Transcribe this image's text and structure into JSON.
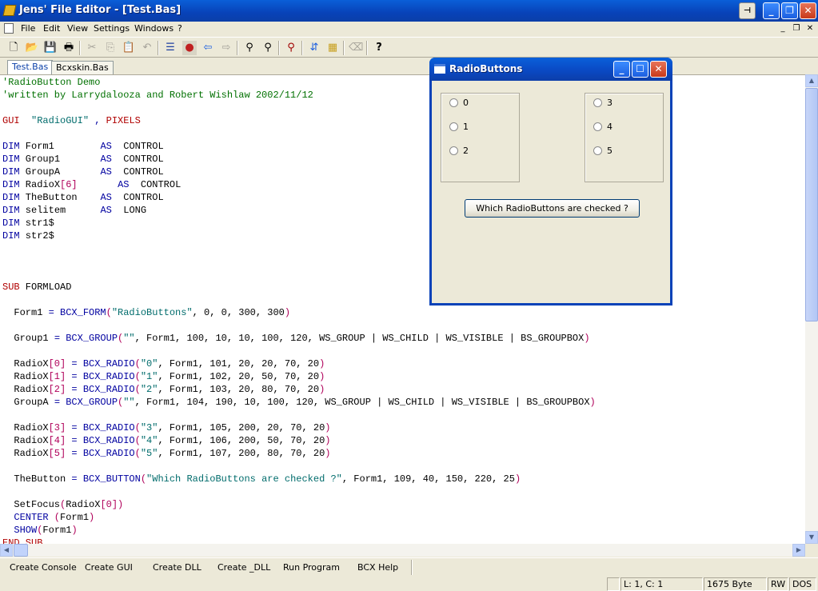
{
  "window": {
    "title": "Jens' File Editor - [Test.Bas]",
    "buttons": {
      "pin": "⊣",
      "minimize": "_",
      "maximize": "❐",
      "close": "✕"
    }
  },
  "menu": {
    "items": [
      "File",
      "Edit",
      "View",
      "Settings",
      "Windows",
      "?"
    ],
    "mdi": {
      "minimize": "_",
      "restore": "❐",
      "close": "✕"
    }
  },
  "toolbar": {
    "icons": [
      "new-file-icon",
      "open-folder-icon",
      "save-icon",
      "print-icon",
      "cut-icon",
      "copy-icon",
      "paste-icon",
      "undo-icon",
      "list-icon",
      "color-icon",
      "back-icon",
      "forward-icon",
      "find-icon",
      "find-replace-icon",
      "find-next-icon",
      "goto-icon",
      "compile-icon",
      "delete-icon",
      "help-icon"
    ]
  },
  "tabs": [
    {
      "label": "Test.Bas",
      "active": true
    },
    {
      "label": "Bcxskin.Bas",
      "active": false
    }
  ],
  "code_lines": [
    [
      [
        "cm",
        "'RadioButton Demo"
      ]
    ],
    [
      [
        "cm",
        "'written by Larrydalooza and Robert Wishlaw 2002/11/12"
      ]
    ],
    [],
    [
      [
        "kw",
        "GUI"
      ],
      [
        "",
        "  "
      ],
      [
        "st",
        "\"RadioGUI\""
      ],
      [
        "kb",
        " , "
      ],
      [
        "kw",
        "PIXELS"
      ]
    ],
    [],
    [
      [
        "kb",
        "DIM"
      ],
      [
        "",
        " Form1        "
      ],
      [
        "kb",
        "AS"
      ],
      [
        "",
        "  CONTROL"
      ]
    ],
    [
      [
        "kb",
        "DIM"
      ],
      [
        "",
        " Group1       "
      ],
      [
        "kb",
        "AS"
      ],
      [
        "",
        "  CONTROL"
      ]
    ],
    [
      [
        "kb",
        "DIM"
      ],
      [
        "",
        " GroupA       "
      ],
      [
        "kb",
        "AS"
      ],
      [
        "",
        "  CONTROL"
      ]
    ],
    [
      [
        "kb",
        "DIM"
      ],
      [
        "",
        " RadioX"
      ],
      [
        "nm",
        "[6]"
      ],
      [
        "",
        "       "
      ],
      [
        "kb",
        "AS"
      ],
      [
        "",
        "  CONTROL"
      ]
    ],
    [
      [
        "kb",
        "DIM"
      ],
      [
        "",
        " TheButton    "
      ],
      [
        "kb",
        "AS"
      ],
      [
        "",
        "  CONTROL"
      ]
    ],
    [
      [
        "kb",
        "DIM"
      ],
      [
        "",
        " selitem      "
      ],
      [
        "kb",
        "AS"
      ],
      [
        "",
        "  LONG"
      ]
    ],
    [
      [
        "kb",
        "DIM"
      ],
      [
        "",
        " str1$"
      ]
    ],
    [
      [
        "kb",
        "DIM"
      ],
      [
        "",
        " str2$"
      ]
    ],
    [],
    [],
    [],
    [
      [
        "kw",
        "SUB"
      ],
      [
        "",
        " FORMLOAD"
      ]
    ],
    [],
    [
      [
        "",
        "  Form1 "
      ],
      [
        "kb",
        "="
      ],
      [
        "kb",
        " BCX_FORM"
      ],
      [
        "nm",
        "("
      ],
      [
        "st",
        "\"RadioButtons\""
      ],
      [
        "",
        ", 0, 0, 300, 300"
      ],
      [
        "nm",
        ")"
      ]
    ],
    [],
    [
      [
        "",
        "  Group1 "
      ],
      [
        "kb",
        "="
      ],
      [
        "kb",
        " BCX_GROUP"
      ],
      [
        "nm",
        "("
      ],
      [
        "st",
        "\"\""
      ],
      [
        "",
        ", Form1, 100, 10, 10, 100, 120, WS_GROUP | WS_CHILD | WS_VISIBLE | BS_GROUPBOX"
      ],
      [
        "nm",
        ")"
      ]
    ],
    [],
    [
      [
        "",
        "  RadioX"
      ],
      [
        "nm",
        "[0]"
      ],
      [
        "kb",
        " = BCX_RADIO"
      ],
      [
        "nm",
        "("
      ],
      [
        "st",
        "\"0\""
      ],
      [
        "",
        ", Form1, 101, 20, 20, 70, 20"
      ],
      [
        "nm",
        ")"
      ]
    ],
    [
      [
        "",
        "  RadioX"
      ],
      [
        "nm",
        "[1]"
      ],
      [
        "kb",
        " = BCX_RADIO"
      ],
      [
        "nm",
        "("
      ],
      [
        "st",
        "\"1\""
      ],
      [
        "",
        ", Form1, 102, 20, 50, 70, 20"
      ],
      [
        "nm",
        ")"
      ]
    ],
    [
      [
        "",
        "  RadioX"
      ],
      [
        "nm",
        "[2]"
      ],
      [
        "kb",
        " = BCX_RADIO"
      ],
      [
        "nm",
        "("
      ],
      [
        "st",
        "\"2\""
      ],
      [
        "",
        ", Form1, 103, 20, 80, 70, 20"
      ],
      [
        "nm",
        ")"
      ]
    ],
    [
      [
        "",
        "  GroupA "
      ],
      [
        "kb",
        "="
      ],
      [
        "kb",
        " BCX_GROUP"
      ],
      [
        "nm",
        "("
      ],
      [
        "st",
        "\"\""
      ],
      [
        "",
        ", Form1, 104, 190, 10, 100, 120, WS_GROUP | WS_CHILD | WS_VISIBLE | BS_GROUPBOX"
      ],
      [
        "nm",
        ")"
      ]
    ],
    [],
    [
      [
        "",
        "  RadioX"
      ],
      [
        "nm",
        "[3]"
      ],
      [
        "kb",
        " = BCX_RADIO"
      ],
      [
        "nm",
        "("
      ],
      [
        "st",
        "\"3\""
      ],
      [
        "",
        ", Form1, 105, 200, 20, 70, 20"
      ],
      [
        "nm",
        ")"
      ]
    ],
    [
      [
        "",
        "  RadioX"
      ],
      [
        "nm",
        "[4]"
      ],
      [
        "kb",
        " = BCX_RADIO"
      ],
      [
        "nm",
        "("
      ],
      [
        "st",
        "\"4\""
      ],
      [
        "",
        ", Form1, 106, 200, 50, 70, 20"
      ],
      [
        "nm",
        ")"
      ]
    ],
    [
      [
        "",
        "  RadioX"
      ],
      [
        "nm",
        "[5]"
      ],
      [
        "kb",
        " = BCX_RADIO"
      ],
      [
        "nm",
        "("
      ],
      [
        "st",
        "\"5\""
      ],
      [
        "",
        ", Form1, 107, 200, 80, 70, 20"
      ],
      [
        "nm",
        ")"
      ]
    ],
    [],
    [
      [
        "",
        "  TheButton "
      ],
      [
        "kb",
        "="
      ],
      [
        "kb",
        " BCX_BUTTON"
      ],
      [
        "nm",
        "("
      ],
      [
        "st",
        "\"Which RadioButtons are checked ?\""
      ],
      [
        "",
        ", Form1, 109, 40, 150, 220, 25"
      ],
      [
        "nm",
        ")"
      ]
    ],
    [],
    [
      [
        "",
        "  SetFocus"
      ],
      [
        "nm",
        "("
      ],
      [
        "",
        "RadioX"
      ],
      [
        "nm",
        "[0])"
      ]
    ],
    [
      [
        "kb",
        "  CENTER"
      ],
      [
        "nm",
        " ("
      ],
      [
        "",
        "Form1"
      ],
      [
        "nm",
        ")"
      ]
    ],
    [
      [
        "kb",
        "  SHOW"
      ],
      [
        "nm",
        "("
      ],
      [
        "",
        "Form1"
      ],
      [
        "nm",
        ")"
      ]
    ],
    [
      [
        "kw",
        "END SUB"
      ]
    ]
  ],
  "scroll": {
    "up": "▲",
    "down": "▼",
    "left": "◀",
    "right": "▶"
  },
  "bottom_buttons": [
    "Create Console",
    "Create GUI",
    "Create DLL",
    "Create _DLL",
    "Run Program",
    "BCX Help"
  ],
  "status": {
    "position": "L: 1, C: 1",
    "size": "1675 Byte",
    "mode": "RW",
    "format": "DOS"
  },
  "dialog": {
    "title": "RadioButtons",
    "buttons": {
      "minimize": "_",
      "maximize": "☐",
      "close": "✕"
    },
    "group1": [
      "0",
      "1",
      "2"
    ],
    "groupA": [
      "3",
      "4",
      "5"
    ],
    "button_label": "Which RadioButtons are checked ?"
  }
}
